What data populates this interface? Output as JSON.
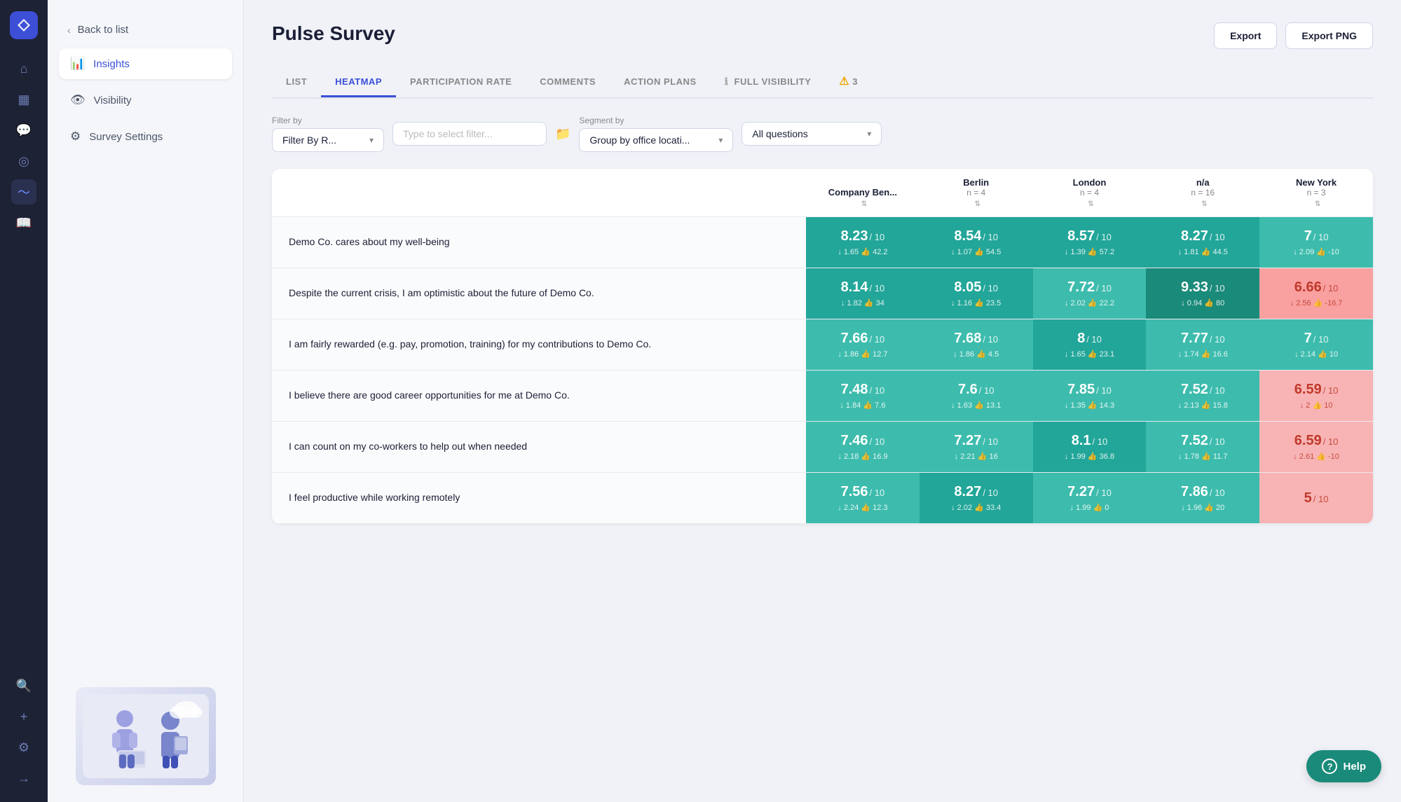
{
  "nav": {
    "logo_symbol": "✈",
    "items": [
      {
        "id": "home",
        "icon": "⌂",
        "active": false
      },
      {
        "id": "calendar",
        "icon": "▦",
        "active": false
      },
      {
        "id": "chat",
        "icon": "💬",
        "active": false
      },
      {
        "id": "target",
        "icon": "◎",
        "active": false
      },
      {
        "id": "pulse",
        "icon": "〜",
        "active": true
      },
      {
        "id": "book",
        "icon": "📖",
        "active": false
      },
      {
        "id": "search",
        "icon": "🔍",
        "active": false
      },
      {
        "id": "plus",
        "icon": "+",
        "active": false
      },
      {
        "id": "settings",
        "icon": "⚙",
        "active": false
      },
      {
        "id": "logout",
        "icon": "→",
        "active": false
      }
    ]
  },
  "sidebar": {
    "back_label": "Back to list",
    "items": [
      {
        "id": "insights",
        "label": "Insights",
        "icon": "📊",
        "active": true
      },
      {
        "id": "visibility",
        "label": "Visibility",
        "icon": "👁",
        "active": false
      },
      {
        "id": "survey-settings",
        "label": "Survey Settings",
        "icon": "⚙",
        "active": false
      }
    ]
  },
  "page": {
    "title": "Pulse Survey"
  },
  "header_buttons": [
    {
      "id": "export",
      "label": "Export"
    },
    {
      "id": "export-png",
      "label": "Export PNG"
    }
  ],
  "tabs": [
    {
      "id": "list",
      "label": "LIST",
      "active": false
    },
    {
      "id": "heatmap",
      "label": "HEATMAP",
      "active": true
    },
    {
      "id": "participation-rate",
      "label": "PARTICIPATION RATE",
      "active": false
    },
    {
      "id": "comments",
      "label": "COMMENTS",
      "active": false
    },
    {
      "id": "action-plans",
      "label": "ACTION PLANS",
      "active": false
    },
    {
      "id": "full-visibility",
      "label": "FULL VISIBILITY",
      "active": false
    },
    {
      "id": "warnings",
      "label": "3",
      "active": false,
      "has_warning": true
    }
  ],
  "filters": {
    "filter_by_label": "Filter by",
    "filter_select_value": "Filter By R...",
    "filter_input_placeholder": "Type to select filter...",
    "segment_by_label": "Segment by",
    "segment_select_value": "Group by office locati...",
    "questions_select_value": "All questions"
  },
  "columns": [
    {
      "id": "company",
      "name": "Company Ben...",
      "sub": "",
      "has_sort": true
    },
    {
      "id": "berlin",
      "name": "Berlin",
      "sub": "n = 4",
      "has_sort": true
    },
    {
      "id": "london",
      "name": "London",
      "sub": "n = 4",
      "has_sort": true
    },
    {
      "id": "na",
      "name": "n/a",
      "sub": "n = 16",
      "has_sort": true
    },
    {
      "id": "new-york",
      "name": "New York",
      "sub": "n = 3",
      "has_sort": true
    }
  ],
  "rows": [
    {
      "id": "row1",
      "question": "Demo Co. cares about my well-being",
      "scores": [
        {
          "value": "8.23",
          "denom": "/ 10",
          "sub": "↓ 1.65  👍 42.2",
          "color": "c-teal-mid"
        },
        {
          "value": "8.54",
          "denom": "/ 10",
          "sub": "↓ 1.07  👍 54.5",
          "color": "c-teal-mid"
        },
        {
          "value": "8.57",
          "denom": "/ 10",
          "sub": "↓ 1.39  👍 57.2",
          "color": "c-teal-mid"
        },
        {
          "value": "8.27",
          "denom": "/ 10",
          "sub": "↓ 1.81  👍 44.5",
          "color": "c-teal-mid"
        },
        {
          "value": "7",
          "denom": "/ 10",
          "sub": "↓ 2.09  👍 -10",
          "color": "c-teal-light"
        }
      ]
    },
    {
      "id": "row2",
      "question": "Despite the current crisis, I am optimistic about the future of Demo Co.",
      "scores": [
        {
          "value": "8.14",
          "denom": "/ 10",
          "sub": "↓ 1.82  👍 34",
          "color": "c-teal-mid"
        },
        {
          "value": "8.05",
          "denom": "/ 10",
          "sub": "↓ 1.16  👍 23.5",
          "color": "c-teal-mid"
        },
        {
          "value": "7.72",
          "denom": "/ 10",
          "sub": "↓ 2.02  👍 22.2",
          "color": "c-teal-light"
        },
        {
          "value": "9.33",
          "denom": "/ 10",
          "sub": "↓ 0.94  👍 80",
          "color": "c-teal-dark"
        },
        {
          "value": "6.66",
          "denom": "/ 10",
          "sub": "↓ 2.56  👍 -16.7",
          "color": "c-red-light"
        }
      ]
    },
    {
      "id": "row3",
      "question": "I am fairly rewarded (e.g. pay, promotion, training) for my contributions to Demo Co.",
      "scores": [
        {
          "value": "7.66",
          "denom": "/ 10",
          "sub": "↓ 1.86  👍 12.7",
          "color": "c-teal-light"
        },
        {
          "value": "7.68",
          "denom": "/ 10",
          "sub": "↓ 1.86  👍 4.5",
          "color": "c-teal-light"
        },
        {
          "value": "8",
          "denom": "/ 10",
          "sub": "↓ 1.65  👍 23.1",
          "color": "c-teal-mid"
        },
        {
          "value": "7.77",
          "denom": "/ 10",
          "sub": "↓ 1.74  👍 16.6",
          "color": "c-teal-light"
        },
        {
          "value": "7",
          "denom": "/ 10",
          "sub": "↓ 2.14  👍 10",
          "color": "c-teal-light"
        }
      ]
    },
    {
      "id": "row4",
      "question": "I believe there are good career opportunities for me at Demo Co.",
      "scores": [
        {
          "value": "7.48",
          "denom": "/ 10",
          "sub": "↓ 1.84  👍 7.6",
          "color": "c-teal-light"
        },
        {
          "value": "7.6",
          "denom": "/ 10",
          "sub": "↓ 1.63  👍 13.1",
          "color": "c-teal-light"
        },
        {
          "value": "7.85",
          "denom": "/ 10",
          "sub": "↓ 1.35  👍 14.3",
          "color": "c-teal-light"
        },
        {
          "value": "7.52",
          "denom": "/ 10",
          "sub": "↓ 2.13  👍 15.8",
          "color": "c-teal-light"
        },
        {
          "value": "6.59",
          "denom": "/ 10",
          "sub": "↓ 2  👍 10",
          "color": "c-pink"
        }
      ]
    },
    {
      "id": "row5",
      "question": "I can count on my co-workers to help out when needed",
      "scores": [
        {
          "value": "7.46",
          "denom": "/ 10",
          "sub": "↓ 2.18  👍 16.9",
          "color": "c-teal-light"
        },
        {
          "value": "7.27",
          "denom": "/ 10",
          "sub": "↓ 2.21  👍 16",
          "color": "c-teal-light"
        },
        {
          "value": "8.1",
          "denom": "/ 10",
          "sub": "↓ 1.99  👍 36.8",
          "color": "c-teal-mid"
        },
        {
          "value": "7.52",
          "denom": "/ 10",
          "sub": "↓ 1.78  👍 11.7",
          "color": "c-teal-light"
        },
        {
          "value": "6.59",
          "denom": "/ 10",
          "sub": "↓ 2.61  👍 -10",
          "color": "c-pink"
        }
      ]
    },
    {
      "id": "row6",
      "question": "I feel productive while working remotely",
      "scores": [
        {
          "value": "7.56",
          "denom": "/ 10",
          "sub": "↓ 2.24  👍 12.3",
          "color": "c-teal-light"
        },
        {
          "value": "8.27",
          "denom": "/ 10",
          "sub": "↓ 2.02  👍 33.4",
          "color": "c-teal-mid"
        },
        {
          "value": "7.27",
          "denom": "/ 10",
          "sub": "↓ 1.99  👍 0",
          "color": "c-teal-light"
        },
        {
          "value": "7.86",
          "denom": "/ 10",
          "sub": "↓ 1.96  👍 20",
          "color": "c-teal-light"
        },
        {
          "value": "5",
          "denom": "/ 10",
          "sub": "",
          "color": "c-pink"
        }
      ]
    }
  ],
  "help": {
    "icon": "?",
    "label": "Help"
  }
}
